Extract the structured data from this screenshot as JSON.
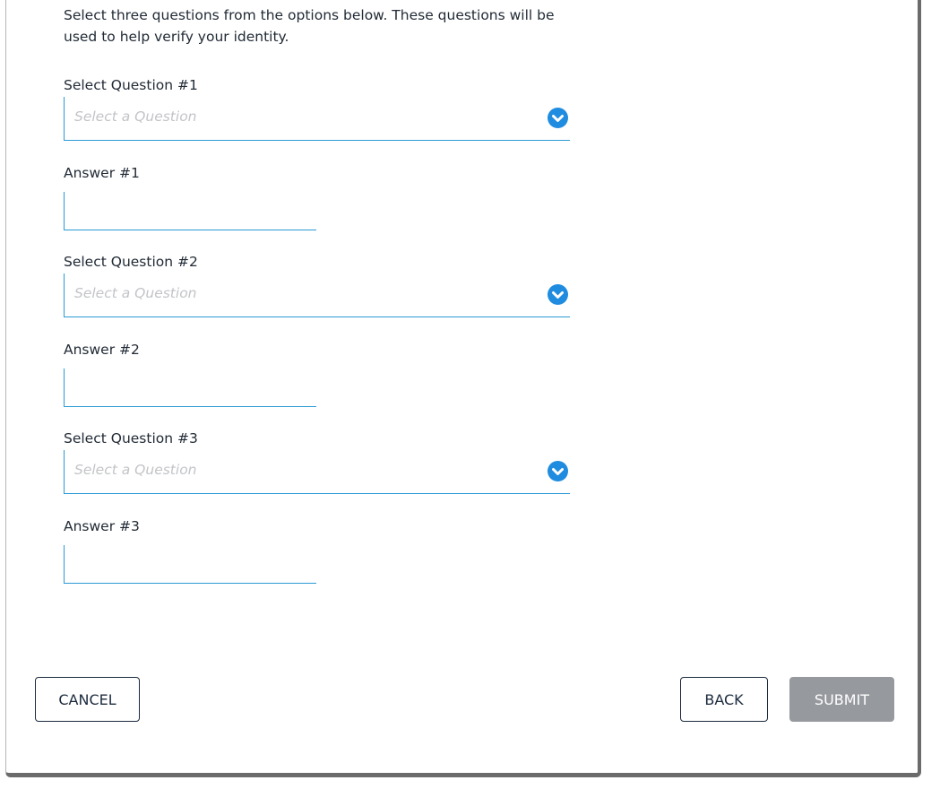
{
  "intro_text": "Select three questions from the options below. These questions will be used to help verify your identity.",
  "questions": [
    {
      "select_label": "Select Question #1",
      "placeholder": "Select a Question",
      "answer_label": "Answer #1",
      "answer_value": ""
    },
    {
      "select_label": "Select Question #2",
      "placeholder": "Select a Question",
      "answer_label": "Answer #2",
      "answer_value": ""
    },
    {
      "select_label": "Select Question #3",
      "placeholder": "Select a Question",
      "answer_label": "Answer #3",
      "answer_value": ""
    }
  ],
  "buttons": {
    "cancel": "CANCEL",
    "back": "BACK",
    "submit": "SUBMIT"
  },
  "colors": {
    "accent": "#1f8ce0",
    "field_border": "#2a9ad6",
    "button_outline": "#1b2a3d",
    "submit_disabled": "#96999e"
  },
  "icons": {
    "dropdown": "chevron-down-circle-icon"
  }
}
